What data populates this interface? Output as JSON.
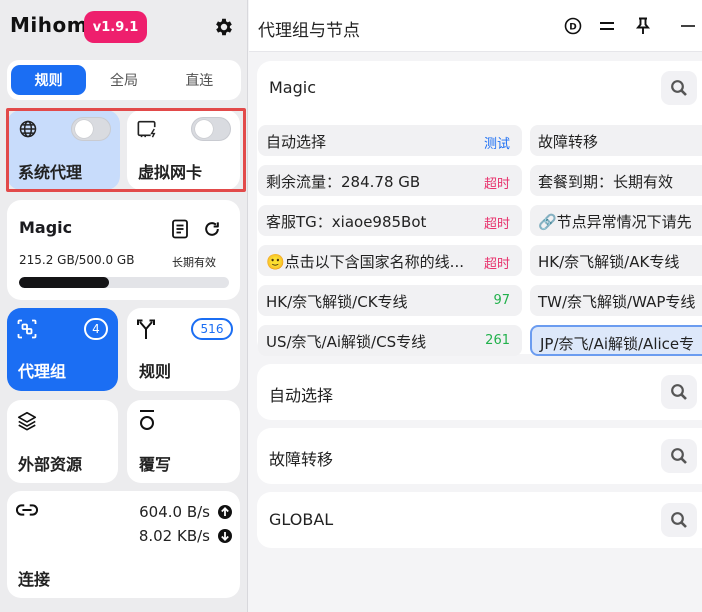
{
  "app": {
    "brand": "Mihomo",
    "version": "v1.9.1"
  },
  "modes": [
    "规则",
    "全局",
    "直连"
  ],
  "active_mode": 0,
  "system_proxy": {
    "label": "系统代理",
    "enabled": false
  },
  "tun": {
    "label": "虚拟网卡",
    "enabled": false
  },
  "profile": {
    "name": "Magic",
    "traffic": "215.2 GB/500.0 GB",
    "expiry": "长期有效",
    "usage_fraction": 0.43
  },
  "nav": {
    "proxies": {
      "label": "代理组",
      "count": "4"
    },
    "rules": {
      "label": "规则",
      "count": "516"
    },
    "resources": {
      "label": "外部资源"
    },
    "override": {
      "label": "覆写"
    }
  },
  "connections": {
    "label": "连接",
    "upload": "604.0 B/s",
    "download": "8.02 KB/s"
  },
  "main": {
    "title": "代理组与节点"
  },
  "groups": [
    {
      "name": "Magic"
    },
    {
      "name": "自动选择"
    },
    {
      "name": "故障转移"
    },
    {
      "name": "GLOBAL"
    }
  ],
  "proxies": [
    {
      "name": "自动选择",
      "delay": "测试",
      "color": "#1b6ef3"
    },
    {
      "name": "故障转移",
      "delay": "",
      "color": ""
    },
    {
      "name": "剩余流量：284.78 GB",
      "delay": "超时",
      "color": "#e8336d"
    },
    {
      "name": "套餐到期：长期有效",
      "delay": "",
      "color": ""
    },
    {
      "name": "客服TG：xiaoe985Bot",
      "delay": "超时",
      "color": "#e8336d"
    },
    {
      "name": "🔗节点异常情况下请先",
      "delay": "",
      "color": ""
    },
    {
      "name": "🙂点击以下含国家名称的线...",
      "delay": "超时",
      "color": "#e8336d"
    },
    {
      "name": "HK/奈飞解锁/AK专线",
      "delay": "",
      "color": ""
    },
    {
      "name": "HK/奈飞解锁/CK专线",
      "delay": "97",
      "color": "#22b14c"
    },
    {
      "name": "TW/奈飞解锁/WAP专线",
      "delay": "",
      "color": ""
    },
    {
      "name": "US/奈飞/Ai解锁/CS专线",
      "delay": "261",
      "color": "#22b14c"
    },
    {
      "name": "JP/奈飞/Ai解锁/Alice专",
      "delay": "",
      "color": ""
    }
  ]
}
